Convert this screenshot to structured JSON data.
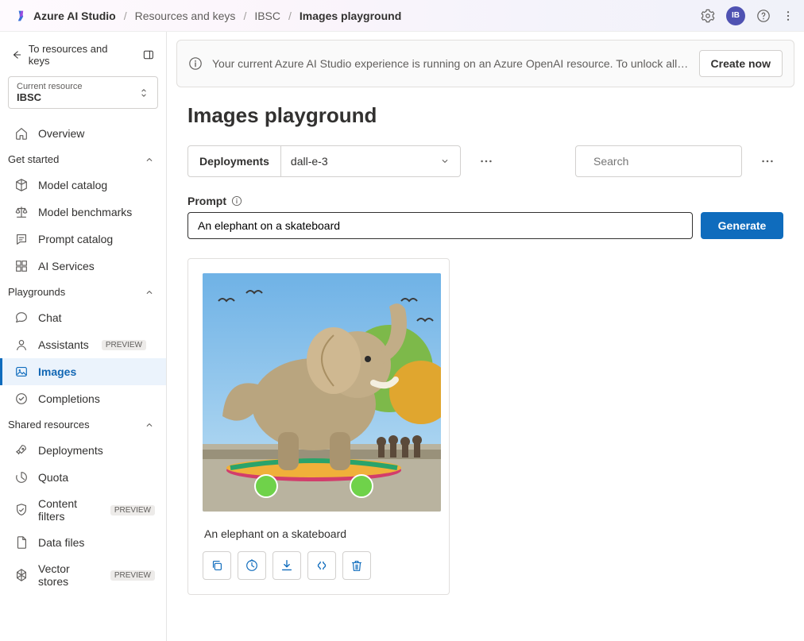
{
  "header": {
    "product": "Azure AI Studio",
    "breadcrumbs": [
      "Resources and keys",
      "IBSC",
      "Images playground"
    ],
    "avatar_initials": "IB"
  },
  "sidebar": {
    "back_label": "To resources and keys",
    "resource": {
      "label": "Current resource",
      "value": "IBSC"
    },
    "overview": "Overview",
    "groups": [
      {
        "title": "Get started",
        "items": [
          {
            "label": "Model catalog",
            "icon": "model-catalog-icon"
          },
          {
            "label": "Model benchmarks",
            "icon": "benchmarks-icon"
          },
          {
            "label": "Prompt catalog",
            "icon": "prompt-catalog-icon"
          },
          {
            "label": "AI Services",
            "icon": "ai-services-icon"
          }
        ]
      },
      {
        "title": "Playgrounds",
        "items": [
          {
            "label": "Chat",
            "icon": "chat-icon"
          },
          {
            "label": "Assistants",
            "icon": "assistants-icon",
            "preview": true
          },
          {
            "label": "Images",
            "icon": "images-icon",
            "selected": true
          },
          {
            "label": "Completions",
            "icon": "completions-icon"
          }
        ]
      },
      {
        "title": "Shared resources",
        "items": [
          {
            "label": "Deployments",
            "icon": "deployments-icon"
          },
          {
            "label": "Quota",
            "icon": "quota-icon"
          },
          {
            "label": "Content filters",
            "icon": "filters-icon",
            "preview": true
          },
          {
            "label": "Data files",
            "icon": "files-icon"
          },
          {
            "label": "Vector stores",
            "icon": "vector-icon",
            "preview": true
          }
        ]
      }
    ],
    "preview_badge": "PREVIEW"
  },
  "banner": {
    "message": "Your current Azure AI Studio experience is running on an Azure OpenAI resource. To unlock all capabilities, create a…",
    "button": "Create now"
  },
  "page": {
    "title": "Images playground",
    "deployments_label": "Deployments",
    "deployment_selected": "dall-e-3",
    "search_placeholder": "Search",
    "prompt_label": "Prompt",
    "prompt_value": "An elephant on a skateboard",
    "generate_label": "Generate",
    "result": {
      "caption": "An elephant on a skateboard"
    }
  }
}
